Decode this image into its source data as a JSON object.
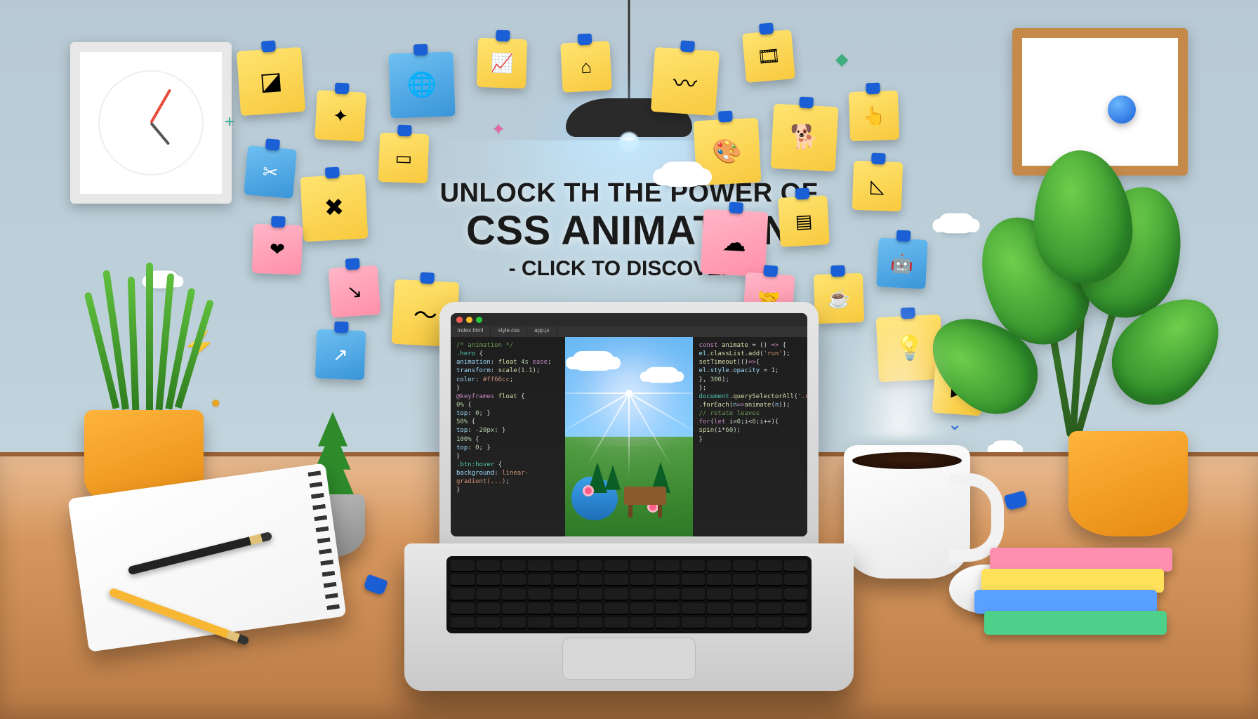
{
  "headline": {
    "line1": "UNLOCK TH THE POWER OF",
    "line2": "CSS ANIMATION",
    "line3": "- CLICK TO DISCOVER !"
  },
  "notes": [
    {
      "id": "note-cube",
      "glyph": "◪",
      "color": "yellow"
    },
    {
      "id": "note-spark",
      "glyph": "✦",
      "color": "yellow"
    },
    {
      "id": "note-globe",
      "glyph": "🌐",
      "color": "blue"
    },
    {
      "id": "note-chart",
      "glyph": "📈",
      "color": "yellow"
    },
    {
      "id": "note-callout",
      "glyph": "⌂",
      "color": "yellow"
    },
    {
      "id": "note-scribble",
      "glyph": "〰",
      "color": "yellow"
    },
    {
      "id": "note-film",
      "glyph": "🎞",
      "color": "yellow"
    },
    {
      "id": "note-scissors",
      "glyph": "✂",
      "color": "blue"
    },
    {
      "id": "note-cross",
      "glyph": "✖",
      "color": "yellow"
    },
    {
      "id": "note-heart",
      "glyph": "❤",
      "color": "pink"
    },
    {
      "id": "note-window",
      "glyph": "▭",
      "color": "yellow"
    },
    {
      "id": "note-palette",
      "glyph": "🎨",
      "color": "yellow"
    },
    {
      "id": "note-dog",
      "glyph": "🐕",
      "color": "yellow"
    },
    {
      "id": "note-hand",
      "glyph": "👆",
      "color": "yellow"
    },
    {
      "id": "note-arrow",
      "glyph": "↘",
      "color": "pink"
    },
    {
      "id": "note-wave",
      "glyph": "〜",
      "color": "yellow"
    },
    {
      "id": "note-cursor",
      "glyph": "↗",
      "color": "blue"
    },
    {
      "id": "note-cloud",
      "glyph": "☁",
      "color": "pink"
    },
    {
      "id": "note-layers",
      "glyph": "▤",
      "color": "yellow"
    },
    {
      "id": "note-hands",
      "glyph": "🤝",
      "color": "pink"
    },
    {
      "id": "note-coffee",
      "glyph": "☕",
      "color": "yellow"
    },
    {
      "id": "note-bot",
      "glyph": "🤖",
      "color": "blue"
    },
    {
      "id": "note-bulb",
      "glyph": "💡",
      "color": "yellow"
    },
    {
      "id": "note-play",
      "glyph": "▶",
      "color": "yellow"
    },
    {
      "id": "note-tri",
      "glyph": "◺",
      "color": "yellow"
    }
  ],
  "floats": {
    "plus": "+",
    "bolt": "⚡",
    "coin": "●",
    "sparkle": "✦",
    "arrow_down": "⌄",
    "diamond": "◆"
  },
  "laptop": {
    "title_dots": [
      "#ff5f56",
      "#ffbd2e",
      "#27c93f"
    ],
    "tabs": [
      "index.html",
      "style.css",
      "app.js"
    ],
    "code_left": [
      {
        "t": "cm",
        "v": "/* animation */"
      },
      {
        "t": "sel",
        "v": ".hero"
      },
      {
        "t": "",
        "v": " {"
      },
      {
        "t": "prop",
        "v": "  animation"
      },
      {
        "t": "",
        "v": ": "
      },
      {
        "t": "fn",
        "v": "float"
      },
      {
        "t": "",
        "v": " "
      },
      {
        "t": "num",
        "v": "4s"
      },
      {
        "t": "",
        "v": " "
      },
      {
        "t": "kw",
        "v": "ease"
      },
      {
        "t": "",
        "v": ";"
      },
      {
        "t": "prop",
        "v": "  transform"
      },
      {
        "t": "",
        "v": ": "
      },
      {
        "t": "fn",
        "v": "scale"
      },
      {
        "t": "",
        "v": "("
      },
      {
        "t": "num",
        "v": "1.1"
      },
      {
        "t": "",
        "v": ");"
      },
      {
        "t": "prop",
        "v": "  color"
      },
      {
        "t": "",
        "v": ": "
      },
      {
        "t": "str",
        "v": "#ff66cc"
      },
      {
        "t": "",
        "v": ";"
      },
      {
        "t": "",
        "v": "}"
      },
      {
        "t": "kw",
        "v": "@keyframes"
      },
      {
        "t": "",
        "v": " "
      },
      {
        "t": "fn",
        "v": "float"
      },
      {
        "t": "",
        "v": " {"
      },
      {
        "t": "num",
        "v": "  0%"
      },
      {
        "t": "",
        "v": " { "
      },
      {
        "t": "prop",
        "v": "top"
      },
      {
        "t": "",
        "v": ": "
      },
      {
        "t": "num",
        "v": "0"
      },
      {
        "t": "",
        "v": "; }"
      },
      {
        "t": "num",
        "v": "  50%"
      },
      {
        "t": "",
        "v": " { "
      },
      {
        "t": "prop",
        "v": "top"
      },
      {
        "t": "",
        "v": ": "
      },
      {
        "t": "num",
        "v": "-20px"
      },
      {
        "t": "",
        "v": "; }"
      },
      {
        "t": "num",
        "v": "  100%"
      },
      {
        "t": "",
        "v": " { "
      },
      {
        "t": "prop",
        "v": "top"
      },
      {
        "t": "",
        "v": ": "
      },
      {
        "t": "num",
        "v": "0"
      },
      {
        "t": "",
        "v": "; }"
      },
      {
        "t": "",
        "v": "}"
      },
      {
        "t": "sel",
        "v": ".btn:hover"
      },
      {
        "t": "",
        "v": " {"
      },
      {
        "t": "prop",
        "v": "  background"
      },
      {
        "t": "",
        "v": ": "
      },
      {
        "t": "str",
        "v": "linear-gradient(...)"
      },
      {
        "t": "",
        "v": ";"
      },
      {
        "t": "",
        "v": "}"
      }
    ],
    "code_right": [
      {
        "t": "kw",
        "v": "const"
      },
      {
        "t": "",
        "v": " "
      },
      {
        "t": "fn",
        "v": "animate"
      },
      {
        "t": "",
        "v": " = () "
      },
      {
        "t": "kw",
        "v": "=>"
      },
      {
        "t": "",
        "v": " {"
      },
      {
        "t": "prop",
        "v": "  el"
      },
      {
        "t": "",
        "v": "."
      },
      {
        "t": "fn",
        "v": "classList"
      },
      {
        "t": "",
        "v": "."
      },
      {
        "t": "fn",
        "v": "add"
      },
      {
        "t": "",
        "v": "("
      },
      {
        "t": "str",
        "v": "'run'"
      },
      {
        "t": "",
        "v": ");"
      },
      {
        "t": "fn",
        "v": "  setTimeout"
      },
      {
        "t": "",
        "v": "(()"
      },
      {
        "t": "kw",
        "v": "=>"
      },
      {
        "t": "",
        "v": "{"
      },
      {
        "t": "prop",
        "v": "    el"
      },
      {
        "t": "",
        "v": "."
      },
      {
        "t": "prop",
        "v": "style"
      },
      {
        "t": "",
        "v": "."
      },
      {
        "t": "prop",
        "v": "opacity"
      },
      {
        "t": "",
        "v": " = "
      },
      {
        "t": "num",
        "v": "1"
      },
      {
        "t": "",
        "v": ";"
      },
      {
        "t": "",
        "v": "  }, "
      },
      {
        "t": "num",
        "v": "300"
      },
      {
        "t": "",
        "v": ");"
      },
      {
        "t": "",
        "v": "};"
      },
      {
        "t": "sel",
        "v": "document"
      },
      {
        "t": "",
        "v": "."
      },
      {
        "t": "fn",
        "v": "querySelectorAll"
      },
      {
        "t": "",
        "v": "("
      },
      {
        "t": "str",
        "v": "'.note'"
      },
      {
        "t": "",
        "v": ")"
      },
      {
        "t": "",
        "v": "  ."
      },
      {
        "t": "fn",
        "v": "forEach"
      },
      {
        "t": "",
        "v": "("
      },
      {
        "t": "prop",
        "v": "n"
      },
      {
        "t": "kw",
        "v": "=>"
      },
      {
        "t": "fn",
        "v": "animate"
      },
      {
        "t": "",
        "v": "("
      },
      {
        "t": "prop",
        "v": "n"
      },
      {
        "t": "",
        "v": "));"
      },
      {
        "t": "cm",
        "v": "// rotate leaves"
      },
      {
        "t": "kw",
        "v": "for"
      },
      {
        "t": "",
        "v": "("
      },
      {
        "t": "kw",
        "v": "let"
      },
      {
        "t": "",
        "v": " i="
      },
      {
        "t": "num",
        "v": "0"
      },
      {
        "t": "",
        "v": ";i<"
      },
      {
        "t": "num",
        "v": "6"
      },
      {
        "t": "",
        "v": ";i++){"
      },
      {
        "t": "fn",
        "v": "  spin"
      },
      {
        "t": "",
        "v": "(i*"
      },
      {
        "t": "num",
        "v": "60"
      },
      {
        "t": "",
        "v": ");"
      },
      {
        "t": "",
        "v": "}"
      }
    ]
  },
  "books": [
    {
      "color": "#ff8fb0"
    },
    {
      "color": "#ffe15a"
    },
    {
      "color": "#5aa0ff"
    },
    {
      "color": "#4cd08a"
    }
  ]
}
